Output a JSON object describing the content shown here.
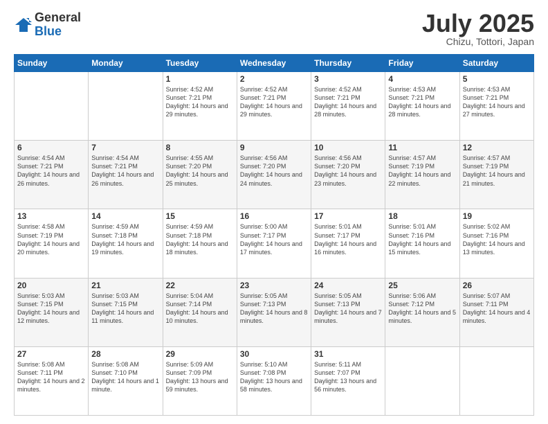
{
  "logo": {
    "general": "General",
    "blue": "Blue"
  },
  "header": {
    "month": "July 2025",
    "location": "Chizu, Tottori, Japan"
  },
  "weekdays": [
    "Sunday",
    "Monday",
    "Tuesday",
    "Wednesday",
    "Thursday",
    "Friday",
    "Saturday"
  ],
  "weeks": [
    [
      {
        "day": "",
        "info": ""
      },
      {
        "day": "",
        "info": ""
      },
      {
        "day": "1",
        "info": "Sunrise: 4:52 AM\nSunset: 7:21 PM\nDaylight: 14 hours and 29 minutes."
      },
      {
        "day": "2",
        "info": "Sunrise: 4:52 AM\nSunset: 7:21 PM\nDaylight: 14 hours and 29 minutes."
      },
      {
        "day": "3",
        "info": "Sunrise: 4:52 AM\nSunset: 7:21 PM\nDaylight: 14 hours and 28 minutes."
      },
      {
        "day": "4",
        "info": "Sunrise: 4:53 AM\nSunset: 7:21 PM\nDaylight: 14 hours and 28 minutes."
      },
      {
        "day": "5",
        "info": "Sunrise: 4:53 AM\nSunset: 7:21 PM\nDaylight: 14 hours and 27 minutes."
      }
    ],
    [
      {
        "day": "6",
        "info": "Sunrise: 4:54 AM\nSunset: 7:21 PM\nDaylight: 14 hours and 26 minutes."
      },
      {
        "day": "7",
        "info": "Sunrise: 4:54 AM\nSunset: 7:21 PM\nDaylight: 14 hours and 26 minutes."
      },
      {
        "day": "8",
        "info": "Sunrise: 4:55 AM\nSunset: 7:20 PM\nDaylight: 14 hours and 25 minutes."
      },
      {
        "day": "9",
        "info": "Sunrise: 4:56 AM\nSunset: 7:20 PM\nDaylight: 14 hours and 24 minutes."
      },
      {
        "day": "10",
        "info": "Sunrise: 4:56 AM\nSunset: 7:20 PM\nDaylight: 14 hours and 23 minutes."
      },
      {
        "day": "11",
        "info": "Sunrise: 4:57 AM\nSunset: 7:19 PM\nDaylight: 14 hours and 22 minutes."
      },
      {
        "day": "12",
        "info": "Sunrise: 4:57 AM\nSunset: 7:19 PM\nDaylight: 14 hours and 21 minutes."
      }
    ],
    [
      {
        "day": "13",
        "info": "Sunrise: 4:58 AM\nSunset: 7:19 PM\nDaylight: 14 hours and 20 minutes."
      },
      {
        "day": "14",
        "info": "Sunrise: 4:59 AM\nSunset: 7:18 PM\nDaylight: 14 hours and 19 minutes."
      },
      {
        "day": "15",
        "info": "Sunrise: 4:59 AM\nSunset: 7:18 PM\nDaylight: 14 hours and 18 minutes."
      },
      {
        "day": "16",
        "info": "Sunrise: 5:00 AM\nSunset: 7:17 PM\nDaylight: 14 hours and 17 minutes."
      },
      {
        "day": "17",
        "info": "Sunrise: 5:01 AM\nSunset: 7:17 PM\nDaylight: 14 hours and 16 minutes."
      },
      {
        "day": "18",
        "info": "Sunrise: 5:01 AM\nSunset: 7:16 PM\nDaylight: 14 hours and 15 minutes."
      },
      {
        "day": "19",
        "info": "Sunrise: 5:02 AM\nSunset: 7:16 PM\nDaylight: 14 hours and 13 minutes."
      }
    ],
    [
      {
        "day": "20",
        "info": "Sunrise: 5:03 AM\nSunset: 7:15 PM\nDaylight: 14 hours and 12 minutes."
      },
      {
        "day": "21",
        "info": "Sunrise: 5:03 AM\nSunset: 7:15 PM\nDaylight: 14 hours and 11 minutes."
      },
      {
        "day": "22",
        "info": "Sunrise: 5:04 AM\nSunset: 7:14 PM\nDaylight: 14 hours and 10 minutes."
      },
      {
        "day": "23",
        "info": "Sunrise: 5:05 AM\nSunset: 7:13 PM\nDaylight: 14 hours and 8 minutes."
      },
      {
        "day": "24",
        "info": "Sunrise: 5:05 AM\nSunset: 7:13 PM\nDaylight: 14 hours and 7 minutes."
      },
      {
        "day": "25",
        "info": "Sunrise: 5:06 AM\nSunset: 7:12 PM\nDaylight: 14 hours and 5 minutes."
      },
      {
        "day": "26",
        "info": "Sunrise: 5:07 AM\nSunset: 7:11 PM\nDaylight: 14 hours and 4 minutes."
      }
    ],
    [
      {
        "day": "27",
        "info": "Sunrise: 5:08 AM\nSunset: 7:11 PM\nDaylight: 14 hours and 2 minutes."
      },
      {
        "day": "28",
        "info": "Sunrise: 5:08 AM\nSunset: 7:10 PM\nDaylight: 14 hours and 1 minute."
      },
      {
        "day": "29",
        "info": "Sunrise: 5:09 AM\nSunset: 7:09 PM\nDaylight: 13 hours and 59 minutes."
      },
      {
        "day": "30",
        "info": "Sunrise: 5:10 AM\nSunset: 7:08 PM\nDaylight: 13 hours and 58 minutes."
      },
      {
        "day": "31",
        "info": "Sunrise: 5:11 AM\nSunset: 7:07 PM\nDaylight: 13 hours and 56 minutes."
      },
      {
        "day": "",
        "info": ""
      },
      {
        "day": "",
        "info": ""
      }
    ]
  ]
}
